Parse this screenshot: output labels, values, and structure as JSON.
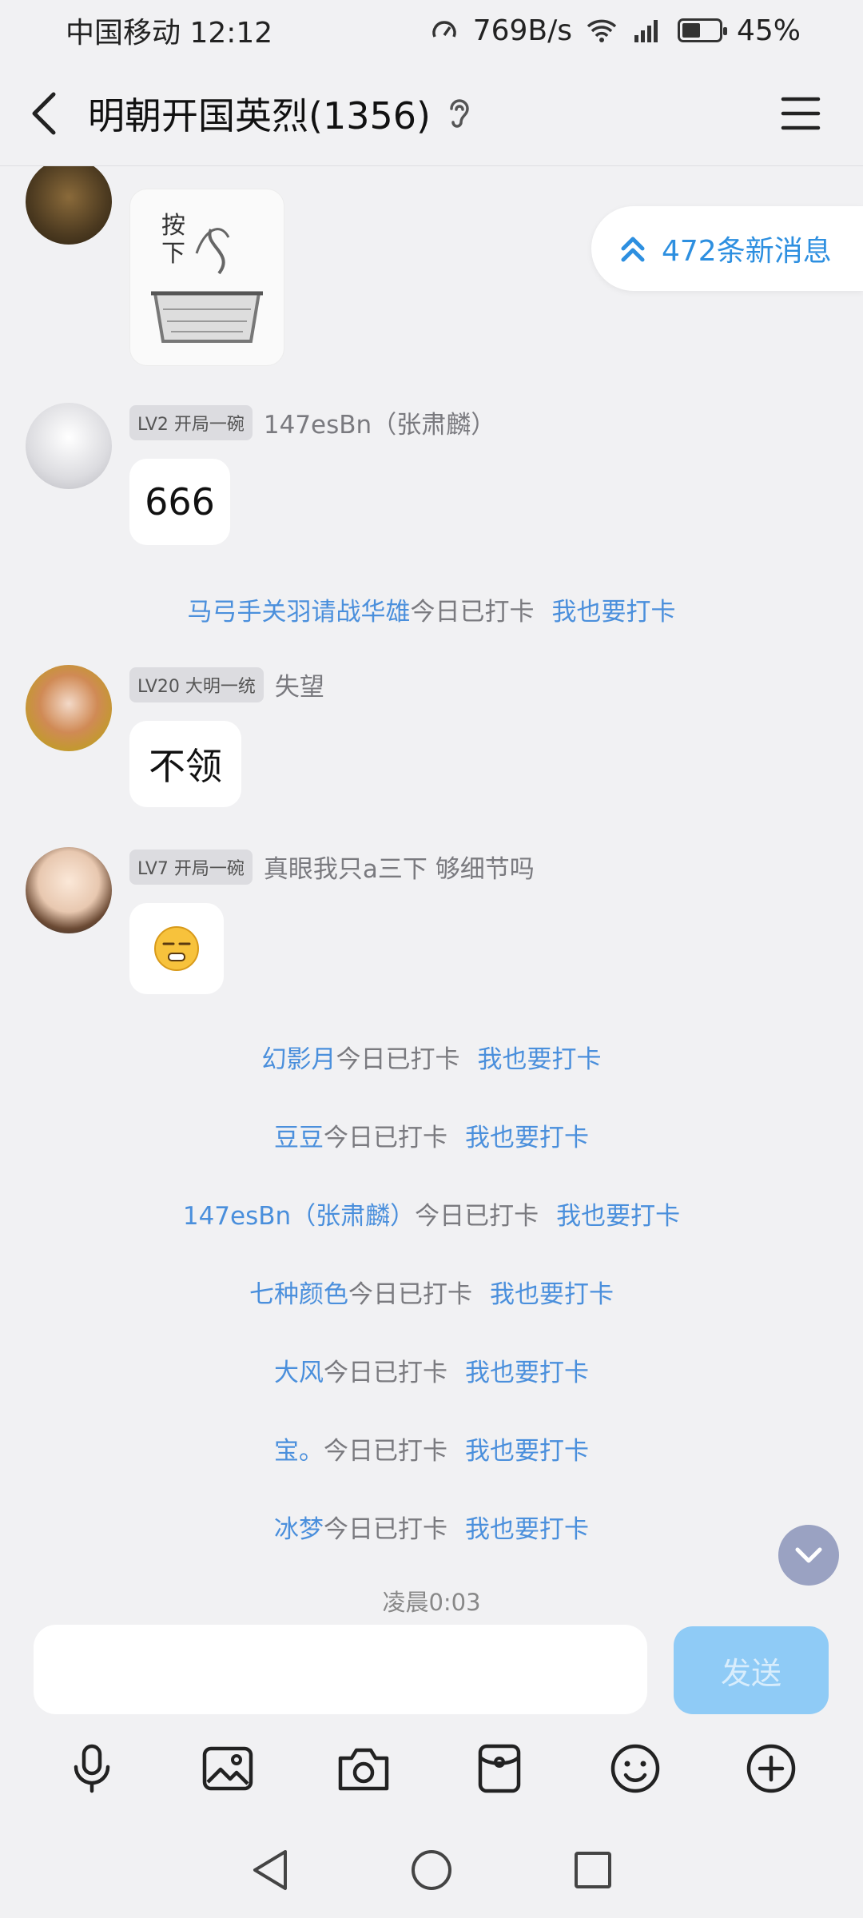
{
  "status": {
    "carrier_time": "中国移动 12:12",
    "speed": "769B/s",
    "battery": "45%"
  },
  "header": {
    "title": "明朝开国英烈(1356)"
  },
  "new_messages": "472条新消息",
  "messages": [
    {
      "level": "LV2 开局一碗",
      "nick": "147esBn（张肃麟）",
      "text": "666"
    },
    {
      "level": "LV20 大明一统",
      "nick": "失望",
      "text": "不领"
    },
    {
      "level": "LV7 开局一碗",
      "nick": "真眼我只a三下 够细节吗"
    }
  ],
  "checkin_suffix": "今日已打卡",
  "checkin_join": "我也要打卡",
  "checkins": [
    "马弓手关羽请战华雄",
    "幻影月",
    "豆豆",
    "147esBn（张肃麟）",
    "七种颜色",
    "大风",
    "宝。",
    "冰梦"
  ],
  "time_label": "凌晨0:03",
  "input": {
    "send_label": "发送"
  }
}
